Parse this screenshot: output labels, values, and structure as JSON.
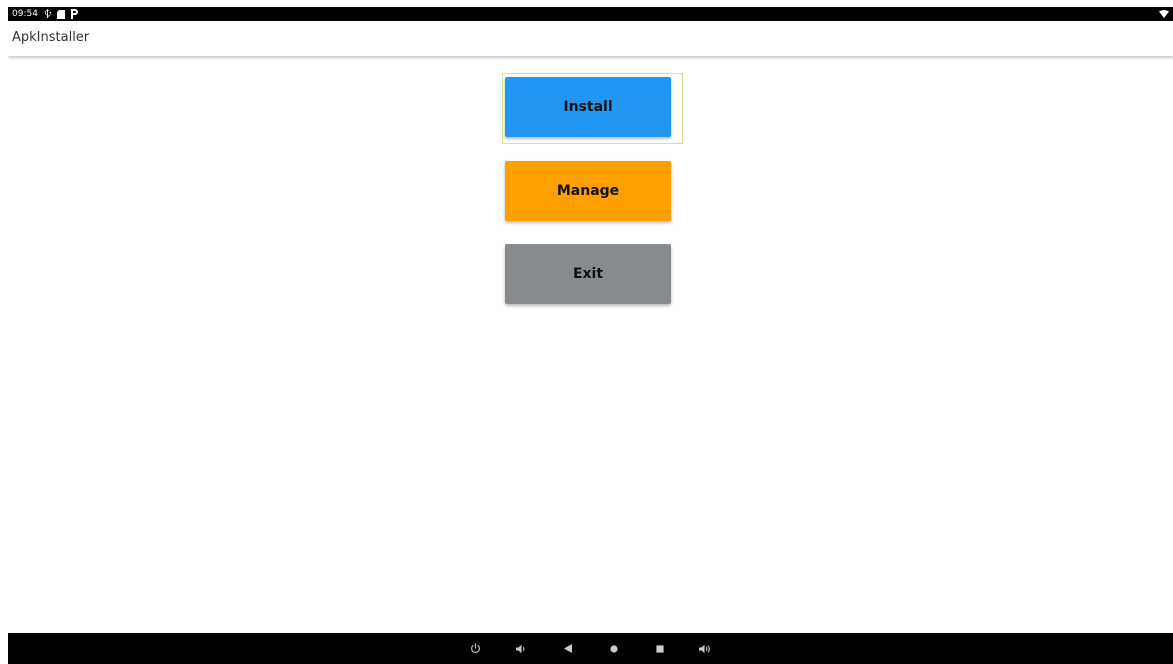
{
  "status_bar": {
    "time": "09:54",
    "icons": [
      "usb-icon",
      "sd-card-icon",
      "parking-icon"
    ],
    "right_icons": [
      "wifi-icon"
    ]
  },
  "app_bar": {
    "title": "ApkInstaller"
  },
  "buttons": {
    "install": {
      "label": "Install",
      "color": "#2196f3"
    },
    "manage": {
      "label": "Manage",
      "color": "#ff9f00"
    },
    "exit": {
      "label": "Exit",
      "color": "#878b8e"
    }
  },
  "nav_bar": {
    "items": [
      "power-icon",
      "volume-down-icon",
      "back-icon",
      "home-icon",
      "recents-icon",
      "volume-up-icon"
    ]
  },
  "colors": {
    "system_bar": "#000000",
    "focus_ring": "#cfe58a"
  }
}
